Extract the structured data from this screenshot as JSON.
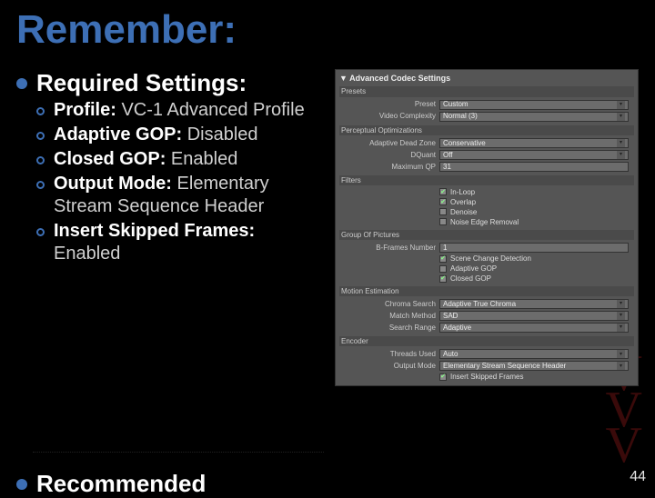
{
  "slide": {
    "title": "Remember:",
    "page_number": "44",
    "partial_next_bullet": "Recommended"
  },
  "bullets": {
    "heading": "Required Settings:",
    "items": [
      {
        "label": "Profile:",
        "value": "VC-1 Advanced Profile"
      },
      {
        "label": "Adaptive GOP:",
        "value": "Disabled"
      },
      {
        "label": "Closed GOP:",
        "value": "Enabled"
      },
      {
        "label": "Output Mode:",
        "value": "Elementary Stream Sequence Header"
      },
      {
        "label": "Insert Skipped Frames:",
        "value": "Enabled"
      }
    ]
  },
  "panel": {
    "title": "Advanced Codec Settings",
    "presets": {
      "preset_label": "Preset",
      "preset_value": "Custom",
      "complexity_label": "Video Complexity",
      "complexity_value": "Normal (3)"
    },
    "perceptual": {
      "section": "Perceptual Optimizations",
      "adz_label": "Adaptive Dead Zone",
      "adz_value": "Conservative",
      "dquant_label": "DQuant",
      "dquant_value": "Off",
      "maxqp_label": "Maximum QP",
      "maxqp_value": "31"
    },
    "filters": {
      "section": "Filters",
      "inloop": "In-Loop",
      "overlap": "Overlap",
      "denoise": "Denoise",
      "noise_edge": "Noise Edge Removal"
    },
    "gop": {
      "section": "Group Of Pictures",
      "bframes_label": "B-Frames Number",
      "bframes_value": "1",
      "scene": "Scene Change Detection",
      "adaptive": "Adaptive GOP",
      "closed": "Closed GOP"
    },
    "motion": {
      "section": "Motion Estimation",
      "chroma_label": "Chroma Search",
      "chroma_value": "Adaptive True Chroma",
      "match_label": "Match Method",
      "match_value": "SAD",
      "range_label": "Search Range",
      "range_value": "Adaptive"
    },
    "encoder": {
      "section": "Encoder",
      "threads_label": "Threads Used",
      "threads_value": "Auto",
      "output_label": "Output Mode",
      "output_value": "Elementary Stream Sequence Header",
      "insert": "Insert Skipped Frames"
    }
  }
}
